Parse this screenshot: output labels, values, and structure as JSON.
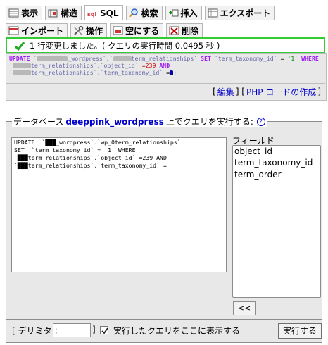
{
  "tabs": {
    "row1": [
      {
        "label": "表示",
        "icon": "browse-icon"
      },
      {
        "label": "構造",
        "icon": "structure-icon"
      },
      {
        "label": "SQL",
        "icon": "sql-icon",
        "active": true
      },
      {
        "label": "検索",
        "icon": "search-icon"
      },
      {
        "label": "挿入",
        "icon": "insert-icon"
      },
      {
        "label": "エクスポート",
        "icon": "export-icon"
      }
    ],
    "row2": [
      {
        "label": "インポート",
        "icon": "import-icon"
      },
      {
        "label": "操作",
        "icon": "operations-icon"
      },
      {
        "label": "空にする",
        "icon": "empty-icon"
      },
      {
        "label": "削除",
        "icon": "drop-icon"
      }
    ]
  },
  "result": {
    "message": "1 行変更しました。( クエリの実行時間 0.0495 秒 )",
    "accent": "#33cc33"
  },
  "sql_display": {
    "line1_kw_update": "UPDATE",
    "line1_db_suffix": "_wordpress",
    "line1_table_suffix": "term_relationships",
    "line1_kw_set": "SET",
    "line1_col": "`term_taxonomy_id`",
    "line1_eq": "=",
    "line1_val": "'1'",
    "line1_kw_where": "WHERE",
    "line2_table": "term_relationships",
    "line2_col": "`object_id`",
    "line2_val": "=239",
    "line2_kw_and": "AND",
    "line3_table": "term_relationships",
    "line3_col": "`term_taxonomy_id`",
    "line3_eq": "="
  },
  "sql_links": {
    "edit": "編集",
    "create_php": "PHP コードの作成"
  },
  "query_box": {
    "legend_prefix": "データベース",
    "database": "deeppink_wordpress",
    "legend_suffix": "上でクエリを実行する:",
    "textarea_value": "UPDATE  `███_wordpress`.`wp_0term_relationships`\nSET  `term_taxonomy_id` = '1' WHERE\n`███term_relationships`.`object_id` =239 AND\n`███term_relationships`.`term_taxonomy_id` =",
    "fields_label": "フィールド",
    "fields": [
      "object_id",
      "term_taxonomy_id",
      "term_order"
    ],
    "insert_button": "<<"
  },
  "bottom": {
    "delimiter_label": "[ デリミタ",
    "delimiter_value": ";",
    "close_bracket": "]",
    "show_query_label": "実行したクエリをここに表示する",
    "show_query_checked": true,
    "run_button": "実行する"
  }
}
